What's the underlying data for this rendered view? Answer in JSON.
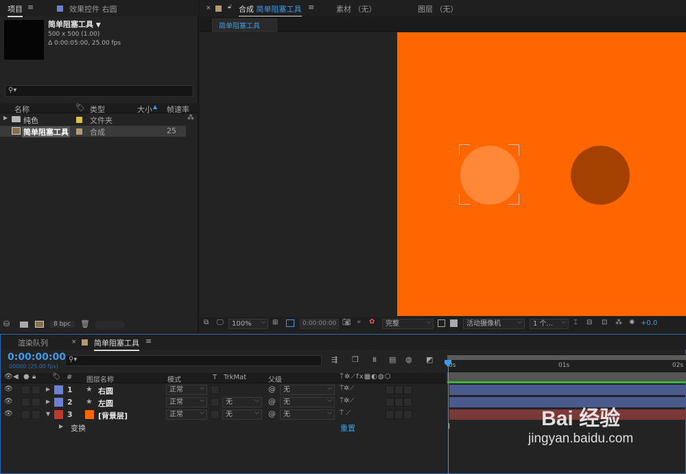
{
  "project_panel": {
    "tab_project": "项目",
    "tab_effects": "效果控件 右圆",
    "comp_name": "简单阻塞工具",
    "comp_size": "500 x 500 (1.00)",
    "comp_duration": "Δ 0:00:05:00, 25.00 fps",
    "columns": {
      "name": "名称",
      "type": "类型",
      "size": "大小",
      "fps": "帧速率"
    },
    "items": [
      {
        "name": "纯色",
        "type": "文件夹",
        "fps": "",
        "color": "#e0c23c"
      },
      {
        "name": "简单阻塞工具",
        "type": "合成",
        "fps": "25",
        "color": "#b39a74"
      }
    ],
    "footer_bpc": "8 bpc"
  },
  "viewer": {
    "tab_comp_prefix": "合成",
    "tab_comp_name": "简单阻塞工具",
    "tab_footage": "素材 （无）",
    "tab_layer": "图层 （无）",
    "breadcrumb": "简单阻塞工具",
    "canvas_color": "#ff6600",
    "circle_left_color": "#ff8838",
    "circle_right_color": "#a44100",
    "toolbar": {
      "zoom": "100%",
      "timecode": "0:00:00:00",
      "resolution": "完整",
      "camera": "活动摄像机",
      "views": "1 个...",
      "exposure": "+0.0"
    }
  },
  "timeline": {
    "tab_render": "渲染队列",
    "tab_comp": "简单阻塞工具",
    "current_time": "0:00:00:00",
    "current_frames": "00000 (25.00 fps)",
    "col_layer_name": "图层名称",
    "col_mode": "模式",
    "col_t": "T",
    "col_trkmat": "TrkMat",
    "col_parent": "父级",
    "ruler": [
      "0s",
      "01s",
      "02s"
    ],
    "layers": [
      {
        "num": "1",
        "name": "右圆",
        "label_color": "#6b7fd4",
        "mode": "正常",
        "trkmat": "",
        "parent": "无",
        "bar_color": "#4a5a8f"
      },
      {
        "num": "2",
        "name": "左圆",
        "label_color": "#6b7fd4",
        "mode": "正常",
        "trkmat": "无",
        "parent": "无",
        "bar_color": "#4a5a8f"
      },
      {
        "num": "3",
        "name": "[背景层]",
        "label_color": "#c0392b",
        "mode": "正常",
        "trkmat": "无",
        "parent": "无",
        "bar_color": "#7a3838"
      }
    ],
    "transform_label": "变换",
    "reset_label": "重置"
  },
  "watermark": {
    "brand": "Bai 经验",
    "url": "jingyan.baidu.com"
  }
}
